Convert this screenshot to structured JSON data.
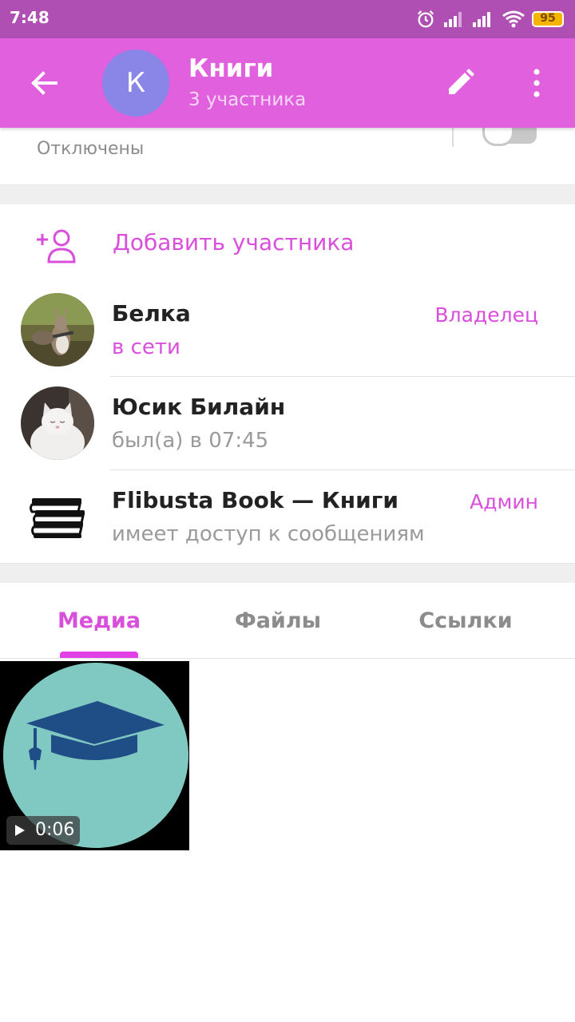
{
  "status_bar": {
    "time": "7:48",
    "battery": "95"
  },
  "header": {
    "title": "Книги",
    "subtitle": "3 участника",
    "avatar_letter": "К"
  },
  "notifications": {
    "label": "Отключены",
    "enabled": false
  },
  "add_participant": {
    "label": "Добавить участника"
  },
  "members": [
    {
      "name": "Белка",
      "status": "в сети",
      "role": "Владелец"
    },
    {
      "name": "Юсик Билайн",
      "status": "был(а) в 07:45",
      "role": ""
    },
    {
      "name": "Flibusta Book — Книги",
      "status": "имеет доступ к сообщениям",
      "role": "Админ"
    }
  ],
  "tabs": [
    {
      "label": "Медиа",
      "active": true
    },
    {
      "label": "Файлы",
      "active": false
    },
    {
      "label": "Ссылки",
      "active": false
    }
  ],
  "media": [
    {
      "duration": "0:06"
    }
  ],
  "colors": {
    "accent": "#d94fdb",
    "header": "#e060de",
    "status_bar": "#b04fb3",
    "avatar": "#8a86e8"
  },
  "icons": [
    "alarm-icon",
    "signal-icon",
    "wifi-icon",
    "battery-icon",
    "back-arrow-icon",
    "pencil-icon",
    "more-vert-icon",
    "add-user-icon",
    "books-icon",
    "graduation-cap-icon",
    "play-icon"
  ]
}
